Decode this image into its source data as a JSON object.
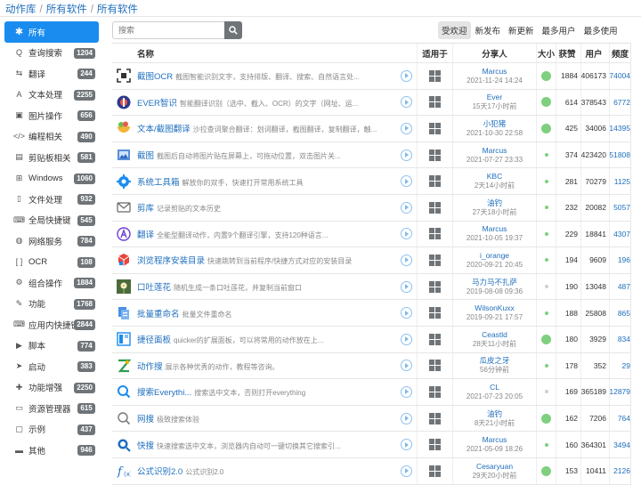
{
  "breadcrumb": [
    "动作库",
    "所有软件",
    "所有软件"
  ],
  "search": {
    "placeholder": "搜索"
  },
  "sort_tabs": [
    "受欢迎",
    "新发布",
    "新更新",
    "最多用户",
    "最多使用"
  ],
  "sidebar": {
    "items": [
      {
        "label": "所有",
        "badge": "",
        "icon": "asterisk-icon",
        "glyph": "✱",
        "active": true
      },
      {
        "label": "查询搜索",
        "badge": "1204",
        "icon": "search-icon",
        "glyph": "Q"
      },
      {
        "label": "翻译",
        "badge": "244",
        "icon": "translate-icon",
        "glyph": "⇆"
      },
      {
        "label": "文本处理",
        "badge": "2255",
        "icon": "text-icon",
        "glyph": "A"
      },
      {
        "label": "图片操作",
        "badge": "656",
        "icon": "image-icon",
        "glyph": "▣"
      },
      {
        "label": "编程相关",
        "badge": "490",
        "icon": "code-icon",
        "glyph": "</>"
      },
      {
        "label": "剪贴板相关",
        "badge": "581",
        "icon": "clipboard-icon",
        "glyph": "▤"
      },
      {
        "label": "Windows",
        "badge": "1060",
        "icon": "windows-icon",
        "glyph": "⊞"
      },
      {
        "label": "文件处理",
        "badge": "932",
        "icon": "file-icon",
        "glyph": "▯"
      },
      {
        "label": "全局快捷键",
        "badge": "545",
        "icon": "keyboard-icon",
        "glyph": "⌨"
      },
      {
        "label": "网络服务",
        "badge": "784",
        "icon": "globe-icon",
        "glyph": "◍"
      },
      {
        "label": "OCR",
        "badge": "108",
        "icon": "ocr-icon",
        "glyph": "[ ]"
      },
      {
        "label": "组合操作",
        "badge": "1884",
        "icon": "gears-icon",
        "glyph": "⚙"
      },
      {
        "label": "功能",
        "badge": "1768",
        "icon": "wrench-icon",
        "glyph": "✎"
      },
      {
        "label": "应用内快捷键",
        "badge": "2844",
        "icon": "keyboard-icon",
        "glyph": "⌨"
      },
      {
        "label": "脚本",
        "badge": "774",
        "icon": "terminal-icon",
        "glyph": "▶"
      },
      {
        "label": "启动",
        "badge": "383",
        "icon": "send-icon",
        "glyph": "➤"
      },
      {
        "label": "功能增强",
        "badge": "2250",
        "icon": "puzzle-icon",
        "glyph": "✚"
      },
      {
        "label": "资源管理器",
        "badge": "615",
        "icon": "hdd-icon",
        "glyph": "▭"
      },
      {
        "label": "示例",
        "badge": "437",
        "icon": "monitor-icon",
        "glyph": "▢"
      },
      {
        "label": "其他",
        "badge": "946",
        "icon": "folder-icon",
        "glyph": "▬"
      }
    ]
  },
  "table": {
    "headers": {
      "name": "名称",
      "fit": "适用于",
      "sharer": "分享人",
      "size": "大小",
      "awards": "获赞",
      "users": "用户",
      "freq": "频度"
    },
    "rows": [
      {
        "title": "截图OCR",
        "desc": "截图智能识别文字，支持排版、翻译、搜索、自然语言处...",
        "icon": "ocr-scan-icon",
        "sharer": "Marcus",
        "time": "2021-11-24 14:24",
        "size": "big",
        "awards": "1884",
        "users": "406173",
        "freq": "74004"
      },
      {
        "title": "EVER智识",
        "desc": "智能翻译识别（选中、截入、OCR）的文字（网址、运...",
        "icon": "ever-icon",
        "sharer": "Ever",
        "time": "15天17小时前",
        "size": "big",
        "awards": "614",
        "users": "378543",
        "freq": "6772"
      },
      {
        "title": "文本/截图翻译",
        "desc": "沙拉查词聚合翻译：划词翻译，截图翻译，复制翻译，触...",
        "icon": "saladict-icon",
        "sharer": "小犯猪",
        "time": "2021-10-30 22:58",
        "size": "big",
        "awards": "425",
        "users": "34006",
        "freq": "14395"
      },
      {
        "title": "截图",
        "desc": "截图后自动将图片贴在屏幕上，可拖动位置，双击图片关...",
        "icon": "screenshot-icon",
        "sharer": "Marcus",
        "time": "2021-07-27 23:33",
        "size": "small",
        "awards": "374",
        "users": "423420",
        "freq": "51808"
      },
      {
        "title": "系统工具箱",
        "desc": "解放你的双手，快速打开常用系统工具",
        "icon": "gear-icon",
        "sharer": "KBC",
        "time": "2天14小时前",
        "size": "small",
        "awards": "281",
        "users": "70279",
        "freq": "1125"
      },
      {
        "title": "剪库",
        "desc": "记录剪贴的文本历史",
        "icon": "envelope-icon",
        "sharer": "油钓",
        "time": "27天18小时前",
        "size": "small",
        "awards": "232",
        "users": "20082",
        "freq": "5057"
      },
      {
        "title": "翻译",
        "desc": "全能型翻译动作，内置9个翻译引擎，支持120种语言...",
        "icon": "translate-a-icon",
        "sharer": "Marcus",
        "time": "2021-10-05 19:37",
        "size": "small",
        "awards": "229",
        "users": "18841",
        "freq": "4307"
      },
      {
        "title": "浏览程序安装目录",
        "desc": "快速跳转到当前程序/快捷方式对应的安装目录",
        "icon": "box-icon",
        "sharer": "i_orange",
        "time": "2020-09-21 20:45",
        "size": "small",
        "awards": "194",
        "users": "9609",
        "freq": "196"
      },
      {
        "title": "口吐莲花",
        "desc": "随机生成一条口吐莲花，并复制当前窗口",
        "icon": "flower-icon",
        "sharer": "马力马不扎萨",
        "time": "2019-08-08 09:36",
        "size": "none",
        "awards": "190",
        "users": "13048",
        "freq": "487"
      },
      {
        "title": "批量重命名",
        "desc": "批量文件重命名",
        "icon": "rename-icon",
        "sharer": "WilsonKuxx",
        "time": "2019-09-21 17:57",
        "size": "small",
        "awards": "188",
        "users": "25808",
        "freq": "865"
      },
      {
        "title": "捷径面板",
        "desc": "quicker的扩展面板，可以将常用的动作放在上...",
        "icon": "panel-icon",
        "sharer": "Ceastld",
        "time": "28天11小时前",
        "size": "big",
        "awards": "180",
        "users": "3929",
        "freq": "834"
      },
      {
        "title": "动作搜",
        "desc": "展示各种优秀的动作，教程等咨询。",
        "icon": "z-logo-icon",
        "sharer": "瓜皮之牙",
        "time": "56分钟前",
        "size": "small",
        "awards": "178",
        "users": "352",
        "freq": "29"
      },
      {
        "title": "搜索Everythi...",
        "desc": "搜索选中文本，否则打开everything",
        "icon": "everything-icon",
        "sharer": "CL",
        "time": "2021-07-23 20:05",
        "size": "none",
        "awards": "169",
        "users": "365189",
        "freq": "12879"
      },
      {
        "title": "网搜",
        "desc": "极致搜索体验",
        "icon": "search-icon",
        "sharer": "油钓",
        "time": "8天21小时前",
        "size": "big",
        "awards": "162",
        "users": "7206",
        "freq": "764"
      },
      {
        "title": "快搜",
        "desc": "快速搜索选中文本，浏览器内自动可一键切换其它搜索引...",
        "icon": "quick-search-icon",
        "sharer": "Marcus",
        "time": "2021-05-09 18:26",
        "size": "small",
        "awards": "160",
        "users": "364301",
        "freq": "3494"
      },
      {
        "title": "公式识别2.0",
        "desc": "公式识别2.0",
        "icon": "formula-icon",
        "sharer": "Cesaryuan",
        "time": "29天20小时前",
        "size": "big",
        "awards": "153",
        "users": "10411",
        "freq": "2126"
      }
    ]
  }
}
